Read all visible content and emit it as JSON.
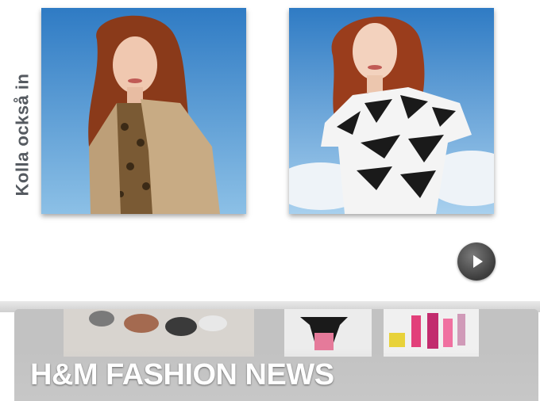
{
  "section": {
    "label": "Kolla också in"
  },
  "thumbnails": [
    {
      "name": "model-beige-jacket"
    },
    {
      "name": "model-zebra-top"
    }
  ],
  "controls": {
    "play_icon": "play-icon"
  },
  "banner": {
    "title": "H&M FASHION NEWS"
  },
  "colors": {
    "sky": "#4a90d0",
    "label": "#555a60",
    "play_button": "#505050",
    "banner_bg": "#c4c4c4"
  }
}
